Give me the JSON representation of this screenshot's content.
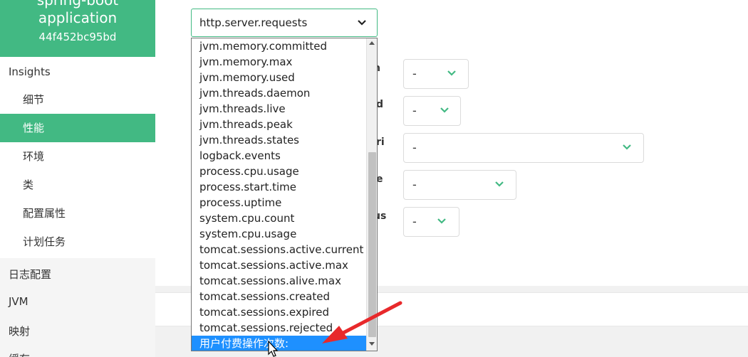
{
  "sidebar": {
    "app_name_line1": "spring-boot",
    "app_name_line2": "application",
    "app_id": "44f452bc95bd",
    "insights_label": "Insights",
    "insights_items": [
      "细节",
      "性能",
      "环境",
      "类",
      "配置属性",
      "计划任务"
    ],
    "active_item": "性能",
    "nav_items": [
      "日志配置",
      "JVM",
      "映射",
      "缓存"
    ]
  },
  "metric_select": {
    "value": "http.server.requests",
    "options": [
      "jvm.memory.committed",
      "jvm.memory.max",
      "jvm.memory.used",
      "jvm.threads.daemon",
      "jvm.threads.live",
      "jvm.threads.peak",
      "jvm.threads.states",
      "logback.events",
      "process.cpu.usage",
      "process.start.time",
      "process.uptime",
      "system.cpu.count",
      "system.cpu.usage",
      "tomcat.sessions.active.current",
      "tomcat.sessions.active.max",
      "tomcat.sessions.alive.max",
      "tomcat.sessions.created",
      "tomcat.sessions.expired",
      "tomcat.sessions.rejected",
      "用户付费操作次数:"
    ],
    "highlighted_option": "用户付费操作次数:"
  },
  "tags": [
    {
      "label_visible": "n",
      "value": "-"
    },
    {
      "label_visible": "d",
      "value": "-"
    },
    {
      "label_visible": "ri",
      "value": "-"
    },
    {
      "label_visible": "e",
      "value": "-"
    },
    {
      "label_visible": "us",
      "value": "-"
    }
  ],
  "icons": {
    "chevron": "chevron-down-icon",
    "cursor": "mouse-pointer-icon",
    "annotation": "red-arrow-icon"
  },
  "colors": {
    "brand": "#42b983",
    "highlight": "#1e90ff",
    "annotation_arrow": "#e8292b"
  }
}
